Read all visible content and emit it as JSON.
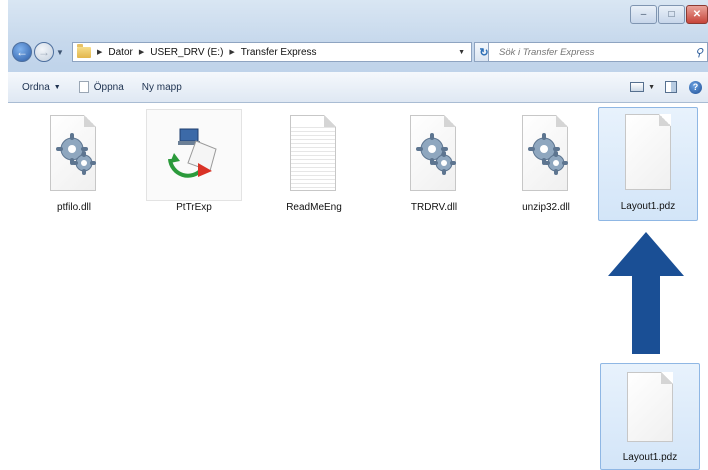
{
  "window": {
    "caption_buttons": [
      {
        "icon": "minimize-icon",
        "glyph": "–"
      },
      {
        "icon": "maximize-icon",
        "glyph": "□"
      },
      {
        "icon": "close-icon",
        "glyph": "✕"
      }
    ]
  },
  "address_bar": {
    "crumbs": [
      "Dator",
      "USER_DRV (E:)",
      "Transfer Express"
    ]
  },
  "search": {
    "placeholder": "Sök i Transfer Express"
  },
  "command_bar": {
    "organize_label": "Ordna",
    "open_label": "Öppna",
    "new_folder_label": "Ny mapp"
  },
  "files": [
    {
      "name": "ptfilo.dll",
      "icon": "dll-gear-icon",
      "selected": false
    },
    {
      "name": "PtTrExp",
      "icon": "transfer-express-app-icon",
      "selected": false
    },
    {
      "name": "ReadMeEng",
      "icon": "text-document-icon",
      "selected": false
    },
    {
      "name": "TRDRV.dll",
      "icon": "dll-gear-icon",
      "selected": false
    },
    {
      "name": "unzip32.dll",
      "icon": "dll-gear-icon",
      "selected": false
    },
    {
      "name": "Layout1.pdz",
      "icon": "blank-document-icon",
      "selected": true
    }
  ],
  "drag_item": {
    "name": "Layout1.pdz",
    "icon": "blank-document-icon"
  },
  "colors": {
    "arrow": "#1a4f95",
    "selection": "#d3e5f8"
  }
}
